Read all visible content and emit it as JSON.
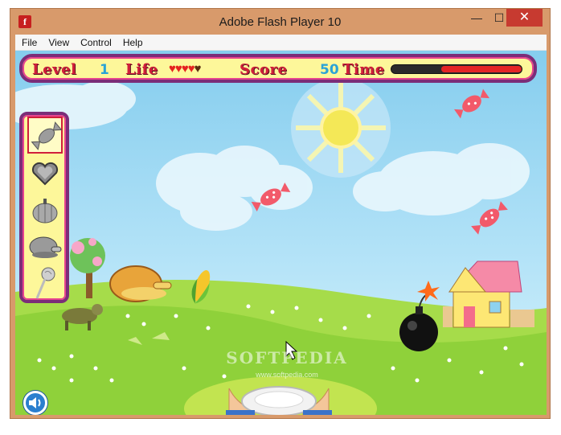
{
  "window": {
    "title": "Adobe Flash Player 10",
    "app_icon": "flash-icon",
    "app_icon_glyph": "f",
    "controls": {
      "minimize": "—",
      "maximize": "☐",
      "close": "✕"
    }
  },
  "menu": [
    "File",
    "View",
    "Control",
    "Help"
  ],
  "hud": {
    "level_label": "Level",
    "level_value": "1",
    "life_label": "Life",
    "lives_total": 5,
    "lives_remaining": 4,
    "score_label": "Score",
    "score_value": "50",
    "time_label": "Time",
    "time_remaining_fraction": 0.62
  },
  "item_panel": {
    "items": [
      "candy-icon",
      "heart-cookie-icon",
      "pumpkin-icon",
      "roast-chicken-icon",
      "lollipop-icon"
    ],
    "selected_index": 0
  },
  "watermark": {
    "text": "SOFTPEDIA",
    "url": "www.softpedia.com"
  },
  "colors": {
    "hud_border": "#7b2d78",
    "hud_fill": "#fdf79a",
    "hud_label": "#d11f3a",
    "hud_value": "#2aa3d6",
    "grass": "#8fd13a",
    "sky": "#85cdee",
    "candy": "#f25a6a"
  }
}
